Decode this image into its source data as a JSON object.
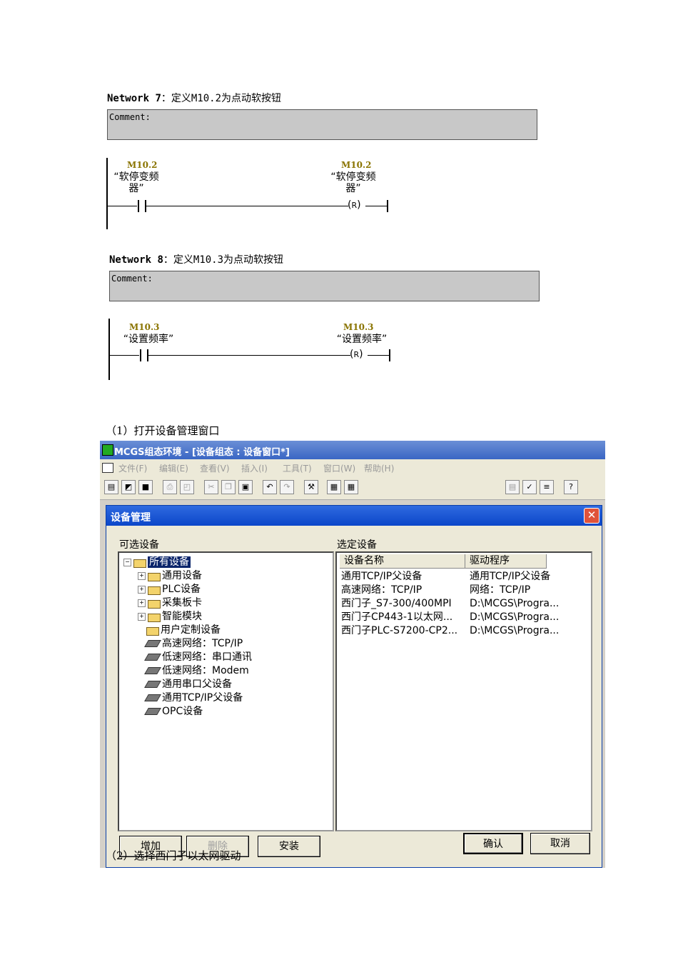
{
  "network7": {
    "label": "Network",
    "number": "7",
    "title": "：定义M10.2为点动软按钮",
    "comment": "Comment:",
    "contact_addr": "M10.2",
    "contact_symbol": "“软停变频\n器”",
    "coil_addr": "M10.2",
    "coil_symbol": "“软停变频\n器”",
    "coil_type": "R"
  },
  "network8": {
    "label": "Network",
    "number": "8",
    "title": "：定义M10.3为点动软按钮",
    "comment": "Comment:",
    "contact_addr": "M10.3",
    "contact_symbol": "“设置频率”",
    "coil_addr": "M10.3",
    "coil_symbol": "“设置频率”",
    "coil_type": "R"
  },
  "caption1": "（1）打开设备管理窗口",
  "caption2": "（2）选择西门子以太网驱动",
  "app": {
    "title": "MCGS组态环境 - [设备组态 : 设备窗口*]",
    "menu": [
      "文件(F)",
      "编辑(E)",
      "查看(V)",
      "插入(I)",
      "工具(T)",
      "窗口(W)",
      "帮助(H)"
    ]
  },
  "dialog": {
    "title": "设备管理",
    "close_glyph": "✕",
    "left_group": "可选设备",
    "right_group": "选定设备",
    "tree": [
      {
        "label": "所有设备",
        "level": 0,
        "expander": "−",
        "icon": "folder-icon",
        "selected": true
      },
      {
        "label": "通用设备",
        "level": 1,
        "expander": "+",
        "icon": "folder-icon"
      },
      {
        "label": "PLC设备",
        "level": 1,
        "expander": "+",
        "icon": "folder-icon"
      },
      {
        "label": "采集板卡",
        "level": 1,
        "expander": "+",
        "icon": "folder-icon"
      },
      {
        "label": "智能模块",
        "level": 1,
        "expander": "+",
        "icon": "folder-icon"
      },
      {
        "label": "用户定制设备",
        "level": 1,
        "expander": "",
        "icon": "folder-icon"
      },
      {
        "label": "高速网络：TCP/IP",
        "level": 1,
        "expander": "",
        "icon": "chip-icon"
      },
      {
        "label": "低速网络：串口通讯",
        "level": 1,
        "expander": "",
        "icon": "chip-icon"
      },
      {
        "label": "低速网络：Modem",
        "level": 1,
        "expander": "",
        "icon": "chip-icon"
      },
      {
        "label": "通用串口父设备",
        "level": 1,
        "expander": "",
        "icon": "chip-icon"
      },
      {
        "label": "通用TCP/IP父设备",
        "level": 1,
        "expander": "",
        "icon": "chip-icon"
      },
      {
        "label": "OPC设备",
        "level": 1,
        "expander": "",
        "icon": "chip-icon"
      }
    ],
    "columns": [
      "设备名称",
      "驱动程序"
    ],
    "rows": [
      [
        "通用TCP/IP父设备",
        "通用TCP/IP父设备"
      ],
      [
        "高速网络：TCP/IP",
        "网络：TCP/IP"
      ],
      [
        "西门子_S7-300/400MPI",
        "D:\\MCGS\\Progra..."
      ],
      [
        "西门子CP443-1以太网...",
        "D:\\MCGS\\Progra..."
      ],
      [
        "西门子PLC-S7200-CP2...",
        "D:\\MCGS\\Progra..."
      ]
    ],
    "buttons": {
      "add": "增加",
      "delete": "删除",
      "install": "安装",
      "ok": "确认",
      "cancel": "取消"
    }
  }
}
